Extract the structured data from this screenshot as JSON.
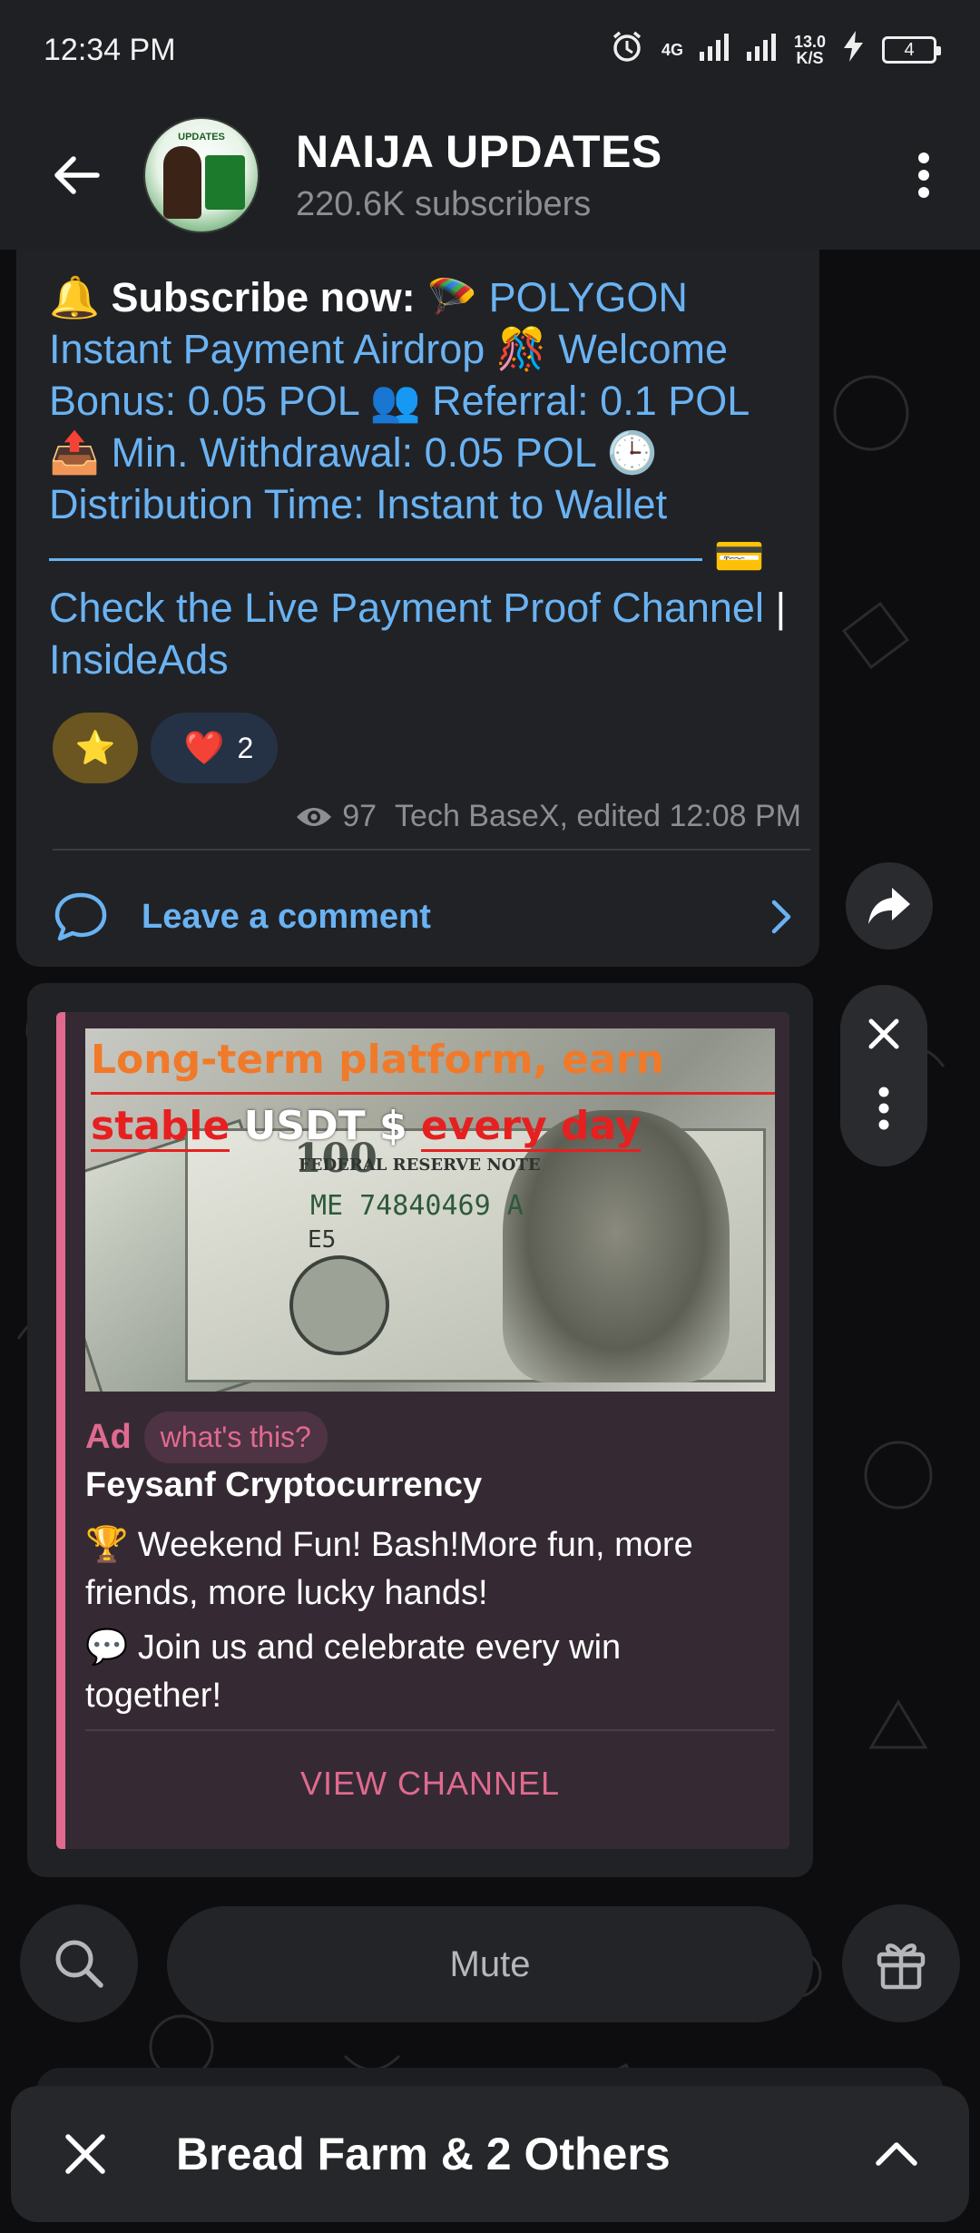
{
  "status_bar": {
    "time": "12:34 PM",
    "network_top": "4G",
    "speed_value": "13.0",
    "speed_unit": "K/S",
    "battery": "4"
  },
  "header": {
    "title": "NAIJA UPDATES",
    "subscribers": "220.6K subscribers",
    "avatar_text": "UPDATES"
  },
  "post": {
    "bell": "🔔",
    "lead": "Subscribe now:",
    "parachute": "🪂",
    "text1": "POLYGON Instant Payment Airdrop",
    "popper": "🎊",
    "text2": "Welcome Bonus: 0.05 POL",
    "people": "👥",
    "text3": "Referral: 0.1 POL",
    "tray": "📤",
    "text4": "Min. Withdrawal: 0.05 POL",
    "clock": "🕒",
    "text5": "Distribution Time: Instant to Wallet",
    "dashes": "————————————————",
    "card": "💳",
    "text6": "Check the Live Payment Proof Channel",
    "pipe": "|",
    "text7": "InsideAds",
    "reactions": [
      {
        "emoji": "⭐",
        "count": ""
      },
      {
        "emoji": "❤️",
        "count": "2"
      }
    ],
    "views": "97",
    "author_edit": "Tech BaseX, edited 12:08 PM",
    "comment_label": "Leave a comment"
  },
  "ad": {
    "image_headline_1": "Long-term platform, earn",
    "image_headline_2a": "stable",
    "image_headline_2b": "USDT $",
    "image_headline_2c": "every day",
    "banknote_denomination": "100",
    "banknote_bank": "FEDERAL RESERVE NOTE",
    "banknote_serial": "ME 74840469 A",
    "banknote_code": "E5",
    "tag": "Ad",
    "whats_this": "what's this?",
    "advertiser": "Feysanf Cryptocurrency",
    "line1_emoji": "🏆",
    "line1": "Weekend Fun! Bash!More fun, more friends, more lucky hands!",
    "line2_emoji": "💬",
    "line2": "Join us and celebrate every win together!",
    "cta": "VIEW CHANNEL"
  },
  "bottom": {
    "mute_label": "Mute",
    "sheet_title": "Bread Farm & 2 Others"
  },
  "colors": {
    "link": "#6ab3f3",
    "ad_accent": "#e06a8f",
    "header_bg": "#1f2023",
    "bubble_bg": "#212226"
  }
}
